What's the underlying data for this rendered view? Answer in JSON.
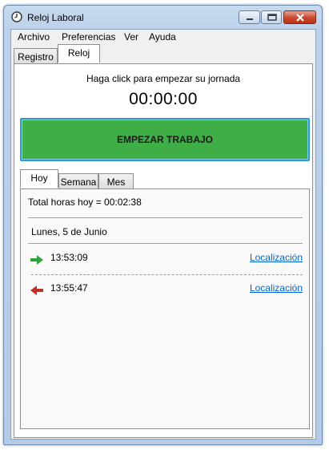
{
  "window": {
    "title": "Reloj Laboral",
    "icon": "clock-icon",
    "controls": [
      "minimize-icon",
      "maximize-icon",
      "close-icon"
    ]
  },
  "menu": {
    "items": [
      {
        "label": "Archivo"
      },
      {
        "label": "Preferencias"
      },
      {
        "label": "Ver"
      },
      {
        "label": "Ayuda"
      }
    ]
  },
  "tabs": {
    "items": [
      {
        "label": "Registro",
        "selected": false
      },
      {
        "label": "Reloj",
        "selected": true
      }
    ]
  },
  "clock": {
    "instruction": "Haga click para empezar su jornada",
    "timer": "00:00:00",
    "start_button": "EMPEZAR TRABAJO",
    "start_button_color": "#3fae47"
  },
  "period_tabs": {
    "items": [
      {
        "label": "Hoy",
        "selected": true
      },
      {
        "label": "Semana",
        "selected": false
      },
      {
        "label": "Mes",
        "selected": false
      }
    ]
  },
  "today": {
    "total": "Total horas hoy = 00:02:38",
    "date": "Lunes, 5 de Junio",
    "entries": [
      {
        "time": "13:53:09",
        "link": "Localización",
        "icon": "arrow-right-green-icon",
        "color": "#2fa33a"
      },
      {
        "time": "13:55:47",
        "link": "Localización",
        "icon": "arrow-left-red-icon",
        "color": "#c0302a"
      }
    ]
  }
}
